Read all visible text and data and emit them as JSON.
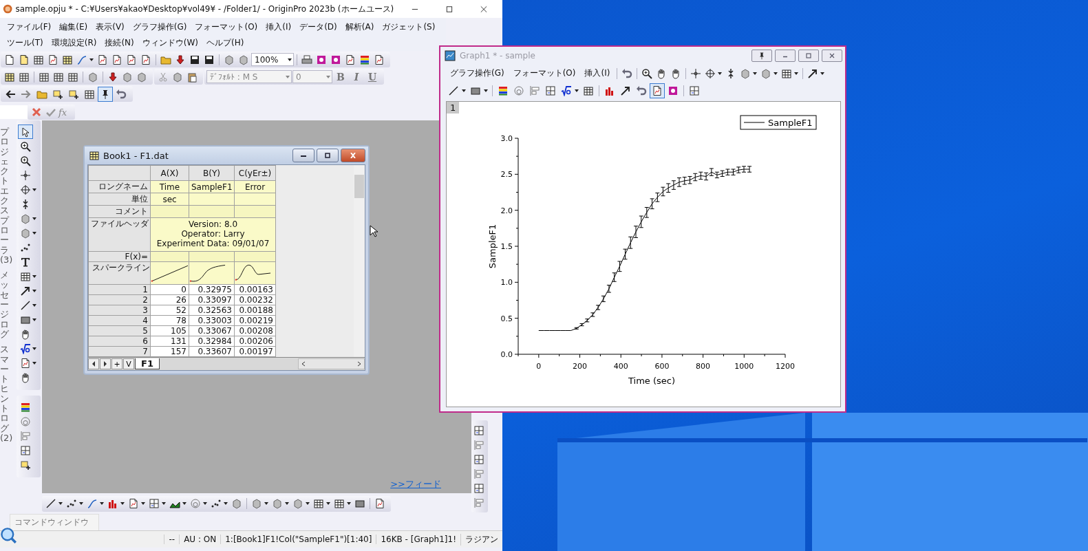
{
  "app_window": {
    "title": "sample.opju * - C:¥Users¥akao¥Desktop¥vol49¥ - /Folder1/ - OriginPro 2023b (ホームユース)",
    "menu": [
      "ファイル(F)",
      "編集(E)",
      "表示(V)",
      "グラフ操作(G)",
      "フォーマット(O)",
      "挿入(I)",
      "データ(D)",
      "解析(A)",
      "ガジェット(S)",
      "ツール(T)",
      "環境設定(R)",
      "接続(N)",
      "ウィンドウ(W)",
      "ヘルプ(H)"
    ],
    "zoom_combo": "100%",
    "font_combo": {
      "value": "ﾃﾞﾌｫﾙﾄ : M S",
      "disabled": true
    },
    "size_combo": {
      "value": "0",
      "disabled": true
    },
    "format_buttons": [
      "B",
      "I",
      "U"
    ],
    "toolbar3_tools": [
      {
        "selected": false
      },
      {
        "selected": false
      },
      {
        "selected": false
      },
      {
        "selected": false
      },
      {
        "selected": false
      },
      {
        "selected": false
      },
      {
        "selected": true
      },
      {
        "selected": false
      }
    ],
    "formula_label": "fx",
    "side_panels": [
      "プロジェクトエクスプローラ(3)",
      "メッセージログ",
      "スマートヒントログ(2)"
    ],
    "left_tools": [
      {
        "selected": true
      },
      {
        "selected": false
      },
      {
        "selected": false
      },
      {
        "selected": false
      },
      {
        "selected": false
      },
      {
        "selected": false
      },
      {
        "selected": false
      },
      {
        "selected": false
      },
      {
        "selected": false
      },
      {
        "selected": false
      },
      {
        "selected": false
      },
      {
        "selected": false
      },
      {
        "selected": false
      },
      {
        "selected": false
      },
      {
        "selected": false
      },
      {
        "selected": false
      },
      {
        "selected": false
      },
      {
        "selected": false
      }
    ],
    "feed_link": ">>フィード",
    "command_window_tab": "コマンドウィンドウ",
    "status_bar": [
      "--",
      "AU : ON",
      "1:[Book1]F1!Col(\"SampleF1\")[1:40]",
      "16KB - [Graph1]1!",
      "ラジアン"
    ]
  },
  "book": {
    "title": "Book1 - F1.dat",
    "columns": [
      "A(X)",
      "B(Y)",
      "C(yEr±)"
    ],
    "label_rows": [
      {
        "kind": "cells",
        "label": "ロングネーム",
        "cells": [
          "Time",
          "SampleF1",
          "Error"
        ]
      },
      {
        "kind": "cells",
        "label": "単位",
        "cells": [
          "sec"
        ]
      },
      {
        "kind": "cells",
        "label": "コメント"
      },
      {
        "kind": "merged",
        "label": "ファイルヘッダ",
        "lines": [
          "Version: 8.0",
          "Operator: Larry",
          "Experiment Data: 09/01/07"
        ]
      },
      {
        "kind": "cells",
        "label": "F(x)="
      },
      {
        "kind": "sparkline",
        "label": "スパークライン"
      }
    ],
    "rows": [
      {
        "index": "1",
        "cells": [
          "0",
          "0.32975",
          "0.00163"
        ]
      },
      {
        "index": "2",
        "cells": [
          "26",
          "0.33097",
          "0.00232"
        ]
      },
      {
        "index": "3",
        "cells": [
          "52",
          "0.32563",
          "0.00188"
        ]
      },
      {
        "index": "4",
        "cells": [
          "78",
          "0.33003",
          "0.00219"
        ]
      },
      {
        "index": "5",
        "cells": [
          "105",
          "0.33067",
          "0.00208"
        ]
      },
      {
        "index": "6",
        "cells": [
          "131",
          "0.32984",
          "0.00206"
        ]
      },
      {
        "index": "7",
        "cells": [
          "157",
          "0.33607",
          "0.00197"
        ]
      }
    ],
    "nav_buttons": [
      "+",
      "V"
    ],
    "sheet_tabs": [
      {
        "label": "F1",
        "selected": true
      }
    ]
  },
  "graph_window": {
    "title": "Graph1 * - sample",
    "active": false,
    "menu": [
      "グラフ操作(G)",
      "フォーマット(O)",
      "挿入(I)"
    ],
    "toolbar2_tools": [
      {
        "selected": false
      },
      {
        "selected": false
      },
      {
        "selected": false
      },
      {
        "selected": false
      },
      {
        "selected": false
      },
      {
        "selected": false
      },
      {
        "selected": false
      },
      {
        "selected": false
      },
      {
        "selected": false
      },
      {
        "selected": true
      },
      {
        "selected": false
      },
      {
        "selected": false
      }
    ],
    "layer": "1",
    "chart_data": {
      "type": "line",
      "xlabel": "Time (sec)",
      "ylabel": "SampleF1",
      "xlim": [
        -100,
        1200
      ],
      "ylim": [
        0,
        3
      ],
      "xticks": [
        0,
        200,
        400,
        600,
        800,
        1000,
        1200
      ],
      "yticks": [
        {
          "value": 0,
          "label": "0.0"
        },
        {
          "value": 0.5,
          "label": "0.5"
        },
        {
          "value": 1,
          "label": "1.0"
        },
        {
          "value": 1.5,
          "label": "1.5"
        },
        {
          "value": 2,
          "label": "2.0"
        },
        {
          "value": 2.5,
          "label": "2.5"
        },
        {
          "value": 3,
          "label": "3.0"
        }
      ],
      "x": [
        0,
        26,
        52,
        78,
        105,
        131,
        157,
        184,
        210,
        236,
        263,
        289,
        315,
        342,
        368,
        394,
        421,
        447,
        473,
        499,
        526,
        552,
        578,
        605,
        631,
        657,
        684,
        710,
        736,
        762,
        789,
        815,
        841,
        868,
        894,
        920,
        947,
        973,
        999,
        1026
      ],
      "series": [
        {
          "name": "SampleF1",
          "color": "#000000",
          "values": [
            0.33,
            0.33,
            0.33,
            0.33,
            0.33,
            0.33,
            0.33,
            0.36,
            0.41,
            0.47,
            0.55,
            0.65,
            0.77,
            0.91,
            1.07,
            1.22,
            1.39,
            1.55,
            1.7,
            1.84,
            1.97,
            2.09,
            2.18,
            2.26,
            2.31,
            2.35,
            2.39,
            2.41,
            2.42,
            2.46,
            2.48,
            2.47,
            2.53,
            2.49,
            2.51,
            2.53,
            2.53,
            2.56,
            2.57,
            2.57
          ],
          "errors": [
            null,
            null,
            null,
            null,
            null,
            null,
            null,
            0.01,
            0.015,
            0.02,
            0.025,
            0.03,
            0.04,
            0.05,
            0.06,
            0.07,
            0.07,
            0.08,
            0.08,
            0.08,
            0.07,
            0.07,
            0.06,
            0.06,
            0.06,
            0.06,
            0.06,
            0.05,
            0.05,
            0.05,
            0.05,
            0.05,
            0.05,
            0.04,
            0.04,
            0.04,
            0.04,
            0.04,
            0.04,
            0.04
          ]
        }
      ]
    }
  }
}
